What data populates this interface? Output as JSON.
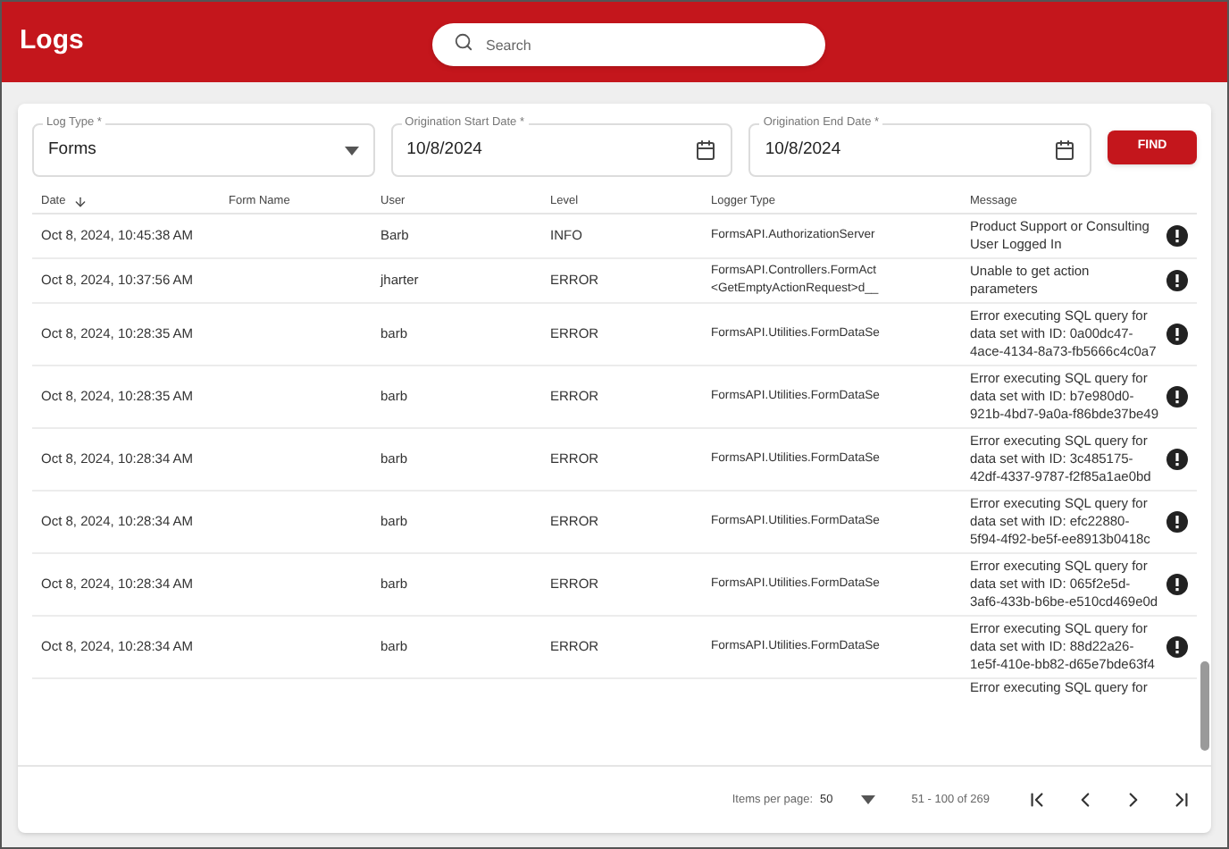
{
  "header": {
    "title": "Logs",
    "search": {
      "placeholder": "Search"
    }
  },
  "filters": [
    {
      "kind": "select",
      "label": "Log Type *",
      "value": "Forms"
    },
    {
      "kind": "date",
      "label": "Origination Start Date *",
      "value": "10/8/2024"
    },
    {
      "kind": "date",
      "label": "Origination End Date *",
      "value": "10/8/2024"
    }
  ],
  "find_button": "FIND",
  "table": {
    "columns": [
      {
        "label": "Date",
        "sorted": true
      },
      {
        "label": "Form Name",
        "sorted": false
      },
      {
        "label": "User",
        "sorted": false
      },
      {
        "label": "Level",
        "sorted": false
      },
      {
        "label": "Logger Type",
        "sorted": false
      },
      {
        "label": "Message",
        "sorted": false
      }
    ],
    "rows": [
      {
        "date": "Oct 8, 2024, 10:45:38 AM",
        "user": "Barb",
        "level": "INFO",
        "logger_type": [
          "FormsAPI.AuthorizationServer"
        ],
        "message": "Product Support or Consulting User Logged In"
      },
      {
        "date": "Oct 8, 2024, 10:37:56 AM",
        "user": "jharter",
        "level": "ERROR",
        "logger_type": [
          "FormsAPI.Controllers.FormAct",
          "<GetEmptyActionRequest>d__"
        ],
        "message": "Unable to get action parameters"
      },
      {
        "date": "Oct 8, 2024, 10:28:35 AM",
        "user": "barb",
        "level": "ERROR",
        "logger_type": [
          "FormsAPI.Utilities.FormDataSe"
        ],
        "message": "Error executing SQL query for data set with ID: 0a00dc47-4ace-4134-8a73-fb5666c4c0a7"
      },
      {
        "date": "Oct 8, 2024, 10:28:35 AM",
        "user": "barb",
        "level": "ERROR",
        "logger_type": [
          "FormsAPI.Utilities.FormDataSe"
        ],
        "message": "Error executing SQL query for data set with ID: b7e980d0-921b-4bd7-9a0a-f86bde37be49"
      },
      {
        "date": "Oct 8, 2024, 10:28:34 AM",
        "user": "barb",
        "level": "ERROR",
        "logger_type": [
          "FormsAPI.Utilities.FormDataSe"
        ],
        "message": "Error executing SQL query for data set with ID: 3c485175-42df-4337-9787-f2f85a1ae0bd"
      },
      {
        "date": "Oct 8, 2024, 10:28:34 AM",
        "user": "barb",
        "level": "ERROR",
        "logger_type": [
          "FormsAPI.Utilities.FormDataSe"
        ],
        "message": "Error executing SQL query for data set with ID: efc22880-5f94-4f92-be5f-ee8913b0418c"
      },
      {
        "date": "Oct 8, 2024, 10:28:34 AM",
        "user": "barb",
        "level": "ERROR",
        "logger_type": [
          "FormsAPI.Utilities.FormDataSe"
        ],
        "message": "Error executing SQL query for data set with ID: 065f2e5d-3af6-433b-b6be-e510cd469e0d"
      },
      {
        "date": "Oct 8, 2024, 10:28:34 AM",
        "user": "barb",
        "level": "ERROR",
        "logger_type": [
          "FormsAPI.Utilities.FormDataSe"
        ],
        "message": "Error executing SQL query for data set with ID: 88d22a26-1e5f-410e-bb82-d65e7bde63f4"
      }
    ],
    "partial_row": {
      "message": "Error executing SQL query for"
    }
  },
  "pagination": {
    "items_per_page_label": "Items per page:",
    "items_per_page": "50",
    "range": "51 - 100 of 269"
  }
}
